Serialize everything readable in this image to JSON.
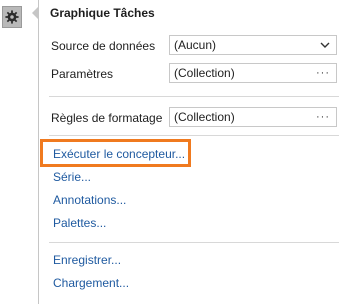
{
  "panel": {
    "title": "Graphique Tâches",
    "properties": [
      {
        "label": "Source de données",
        "value": "(Aucun)",
        "control": "dropdown"
      },
      {
        "label": "Paramètres",
        "value": "(Collection)",
        "control": "ellipsis"
      },
      {
        "label": "Règles de formatage",
        "value": "(Collection)",
        "control": "ellipsis"
      }
    ],
    "actions_group1": [
      {
        "label": "Exécuter le concepteur..."
      },
      {
        "label": "Série..."
      },
      {
        "label": "Annotations..."
      },
      {
        "label": "Palettes..."
      }
    ],
    "actions_group2": [
      {
        "label": "Enregistrer..."
      },
      {
        "label": "Chargement..."
      }
    ],
    "ellipsis_glyph": "···"
  },
  "colors": {
    "link": "#1f5aa0",
    "highlight": "#f07a1f"
  },
  "icons": {
    "smart_tag": "gear-icon",
    "dropdown": "chevron-down-icon"
  }
}
